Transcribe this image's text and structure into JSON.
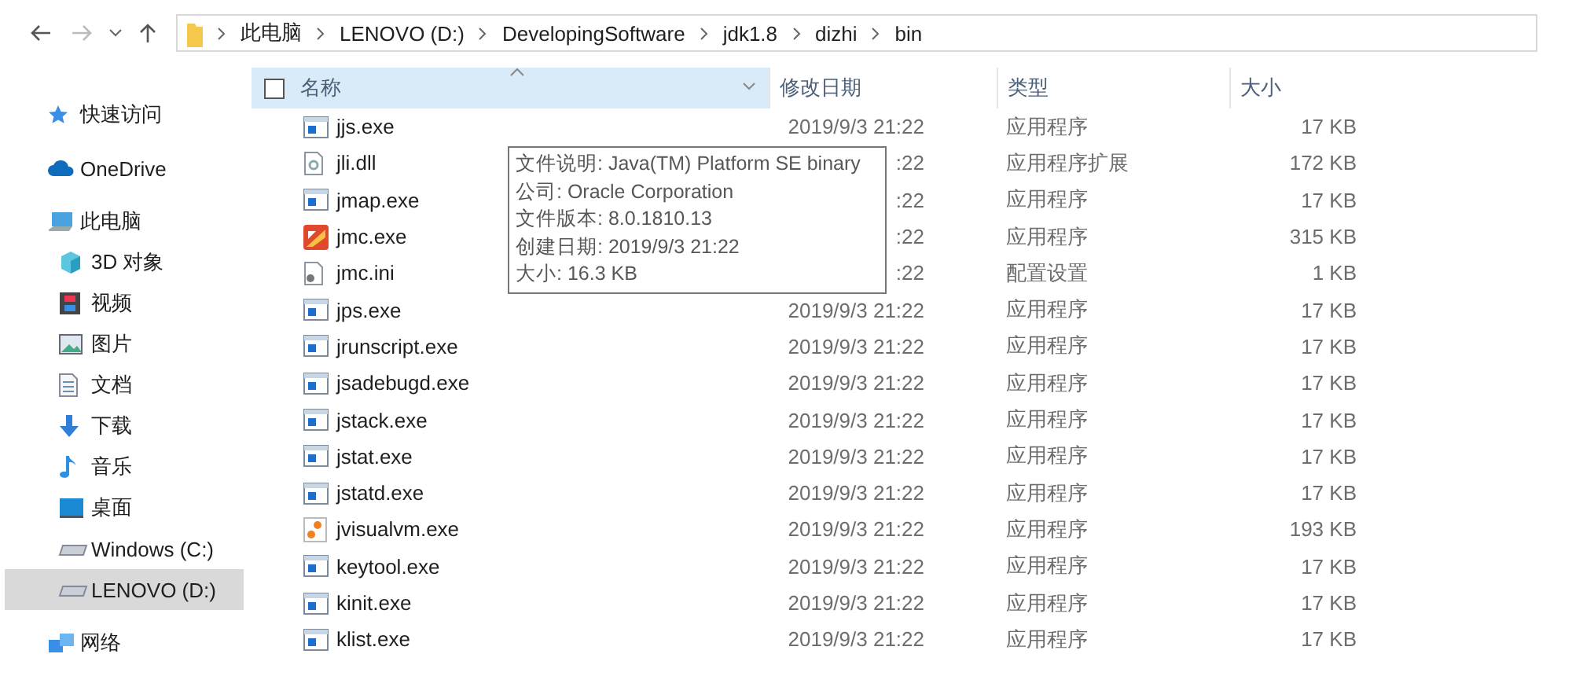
{
  "nav": {
    "breadcrumbs": [
      "此电脑",
      "LENOVO (D:)",
      "DevelopingSoftware",
      "jdk1.8",
      "dizhi",
      "bin"
    ]
  },
  "sidebar": {
    "items": [
      {
        "label": "快速访问",
        "kind": "star",
        "selected": false
      },
      {
        "label": "OneDrive",
        "kind": "cloud",
        "selected": false
      },
      {
        "label": "此电脑",
        "kind": "pc",
        "selected": false,
        "children": [
          {
            "label": "3D 对象",
            "kind": "cube",
            "selected": false
          },
          {
            "label": "视频",
            "kind": "film",
            "selected": false
          },
          {
            "label": "图片",
            "kind": "image",
            "selected": false
          },
          {
            "label": "文档",
            "kind": "doc",
            "selected": false
          },
          {
            "label": "下载",
            "kind": "download",
            "selected": false
          },
          {
            "label": "音乐",
            "kind": "music",
            "selected": false
          },
          {
            "label": "桌面",
            "kind": "desktop",
            "selected": false
          },
          {
            "label": "Windows (C:)",
            "kind": "drive",
            "selected": false
          },
          {
            "label": "LENOVO (D:)",
            "kind": "drive",
            "selected": true
          }
        ]
      },
      {
        "label": "网络",
        "kind": "network",
        "selected": false
      }
    ]
  },
  "table": {
    "select_all": {
      "checked": false
    },
    "columns": [
      "名称",
      "修改日期",
      "类型",
      "大小"
    ],
    "rows": [
      {
        "name": "jjs.exe",
        "kind": "exe",
        "date": "2019/9/3 21:22",
        "type": "应用程序",
        "size": "17 KB"
      },
      {
        "name": "jli.dll",
        "kind": "dll",
        "date": ":22",
        "type": "应用程序扩展",
        "size": "172 KB"
      },
      {
        "name": "jmap.exe",
        "kind": "exe",
        "date": ":22",
        "type": "应用程序",
        "size": "17 KB"
      },
      {
        "name": "jmc.exe",
        "kind": "app",
        "date": ":22",
        "type": "应用程序",
        "size": "315 KB"
      },
      {
        "name": "jmc.ini",
        "kind": "ini",
        "date": ":22",
        "type": "配置设置",
        "size": "1 KB"
      },
      {
        "name": "jps.exe",
        "kind": "exe",
        "date": "2019/9/3 21:22",
        "type": "应用程序",
        "size": "17 KB"
      },
      {
        "name": "jrunscript.exe",
        "kind": "exe",
        "date": "2019/9/3 21:22",
        "type": "应用程序",
        "size": "17 KB"
      },
      {
        "name": "jsadebugd.exe",
        "kind": "exe",
        "date": "2019/9/3 21:22",
        "type": "应用程序",
        "size": "17 KB"
      },
      {
        "name": "jstack.exe",
        "kind": "exe",
        "date": "2019/9/3 21:22",
        "type": "应用程序",
        "size": "17 KB"
      },
      {
        "name": "jstat.exe",
        "kind": "exe",
        "date": "2019/9/3 21:22",
        "type": "应用程序",
        "size": "17 KB"
      },
      {
        "name": "jstatd.exe",
        "kind": "exe",
        "date": "2019/9/3 21:22",
        "type": "应用程序",
        "size": "17 KB"
      },
      {
        "name": "jvisualvm.exe",
        "kind": "vm",
        "date": "2019/9/3 21:22",
        "type": "应用程序",
        "size": "193 KB"
      },
      {
        "name": "keytool.exe",
        "kind": "exe",
        "date": "2019/9/3 21:22",
        "type": "应用程序",
        "size": "17 KB"
      },
      {
        "name": "kinit.exe",
        "kind": "exe",
        "date": "2019/9/3 21:22",
        "type": "应用程序",
        "size": "17 KB"
      },
      {
        "name": "klist.exe",
        "kind": "exe",
        "date": "2019/9/3 21:22",
        "type": "应用程序",
        "size": "17 KB"
      }
    ]
  },
  "tooltip": {
    "lines": [
      "文件说明: Java(TM) Platform SE binary",
      "公司: Oracle Corporation",
      "文件版本: 8.0.1810.13",
      "创建日期: 2019/9/3 21:22",
      "大小: 16.3 KB"
    ]
  }
}
